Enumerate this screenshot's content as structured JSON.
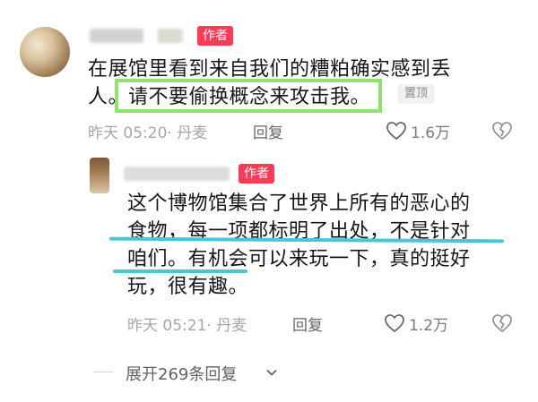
{
  "main_comment": {
    "author_tag": "作者",
    "text_lines": [
      "在展馆里看到来自我们的糟粕确实感到丢",
      "人。请不要偷换概念来攻击我。"
    ],
    "pinned_label": "置顶",
    "timestamp": "昨天 05:20",
    "location": "· 丹麦",
    "reply_label": "回复",
    "like_count": "1.6万",
    "icons": {
      "like": "heart-outline-icon",
      "dislike": "broken-heart-icon"
    }
  },
  "reply_comment": {
    "author_tag": "作者",
    "text_lines": [
      "这个博物馆集合了世界上所有的恶心的",
      "食物，每一项都标明了出处，不是针对",
      "咱们。有机会可以来玩一下，真的挺好",
      "玩，很有趣。"
    ],
    "timestamp": "昨天 05:21",
    "location": "· 丹麦",
    "reply_label": "回复",
    "like_count": "1.2万",
    "icons": {
      "like": "heart-outline-icon",
      "dislike": "broken-heart-icon"
    }
  },
  "expand": {
    "label": "展开269条回复",
    "icon": "chevron-down-icon"
  },
  "colors": {
    "author_tag_bg": "#fb3a58",
    "highlight_box": "#8fe36a",
    "underline": "#45c7d7",
    "meta_text": "#a6a6a6"
  }
}
